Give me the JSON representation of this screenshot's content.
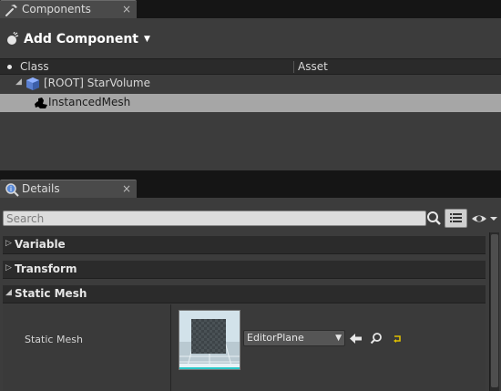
{
  "components_tab": {
    "label": "Components",
    "close": "×"
  },
  "components": {
    "add_button": "Add Component",
    "tree_headers": [
      "Class",
      "Asset"
    ],
    "root_item": "[ROOT] StarVolume",
    "child_item": "InstancedMesh"
  },
  "details_tab": {
    "label": "Details",
    "close": "×"
  },
  "details": {
    "search_placeholder": "Search",
    "categories": [
      "Variable",
      "Transform",
      "Static Mesh"
    ],
    "property_label": "Static Mesh",
    "mesh_value": "EditorPlane"
  },
  "colors": {
    "panel_bg": "#3c3c3c",
    "selected_row": "#a6a6a6",
    "accent_yellow": "#e0c000"
  }
}
